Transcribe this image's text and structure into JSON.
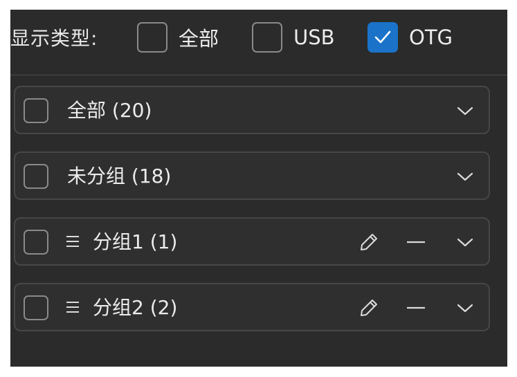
{
  "filter": {
    "label": "显示类型:",
    "options": [
      {
        "label": "全部",
        "checked": false
      },
      {
        "label": "USB",
        "checked": false
      },
      {
        "label": "OTG",
        "checked": true
      }
    ]
  },
  "groups": [
    {
      "label": "全部 (20)",
      "draggable": false,
      "editable": false
    },
    {
      "label": "未分组 (18)",
      "draggable": false,
      "editable": false
    },
    {
      "label": "分组1 (1)",
      "draggable": true,
      "editable": true
    },
    {
      "label": "分组2 (2)",
      "draggable": true,
      "editable": true
    }
  ],
  "colors": {
    "panel_bg": "#2b2b2b",
    "row_border": "#474747",
    "checkbox_border": "#8a8a8a",
    "accent": "#1a73c9",
    "text": "#ececec"
  },
  "icons": {
    "checked": "check-icon",
    "drag": "drag-handle-icon",
    "edit": "pencil-icon",
    "remove": "minus-icon",
    "expand": "chevron-down-icon"
  }
}
